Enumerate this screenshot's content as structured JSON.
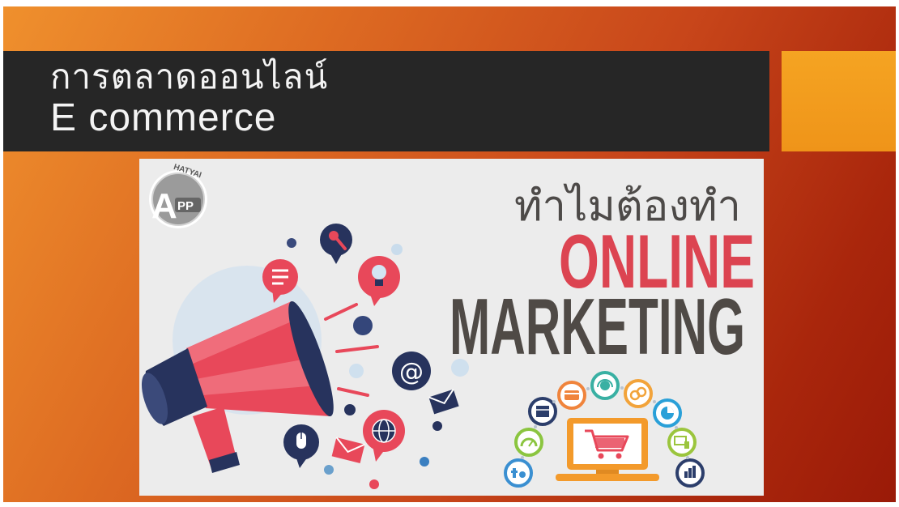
{
  "slide": {
    "title_line1": "การตลาดออนไลน์",
    "title_line2": "E commerce"
  },
  "picture": {
    "heading_thai": "ทำไมต้องทำ",
    "heading_online": "ONLINE",
    "heading_marketing": "MARKETING",
    "at_symbol": "@",
    "logo": {
      "letter": "A",
      "suffix": "PP",
      "arc_text": "HATYAI"
    }
  },
  "icons": [
    "app-hatyai-logo",
    "megaphone",
    "key-bubble-icon",
    "lightbulb-bubble-icon",
    "chat-bubble-icon",
    "at-sign-icon",
    "envelope-icon",
    "globe-bubble-icon",
    "mouse-bubble-icon",
    "laptop-cart-icon",
    "store-icon",
    "speedometer-icon",
    "social-media-icon",
    "credit-card-icon",
    "customer-service-icon",
    "coins-icon",
    "pie-chart-icon",
    "devices-icon",
    "bar-chart-icon"
  ],
  "colors": {
    "background_orange": "#ef902d",
    "background_red": "#9a1a08",
    "title_bar": "#262626",
    "accent_square": "#f29a1b",
    "online_red": "#dc4451",
    "marketing_gray": "#4f4a46",
    "thai_heading_gray": "#4d4a48",
    "navy": "#27335d",
    "megaphone_red": "#e8485a"
  }
}
